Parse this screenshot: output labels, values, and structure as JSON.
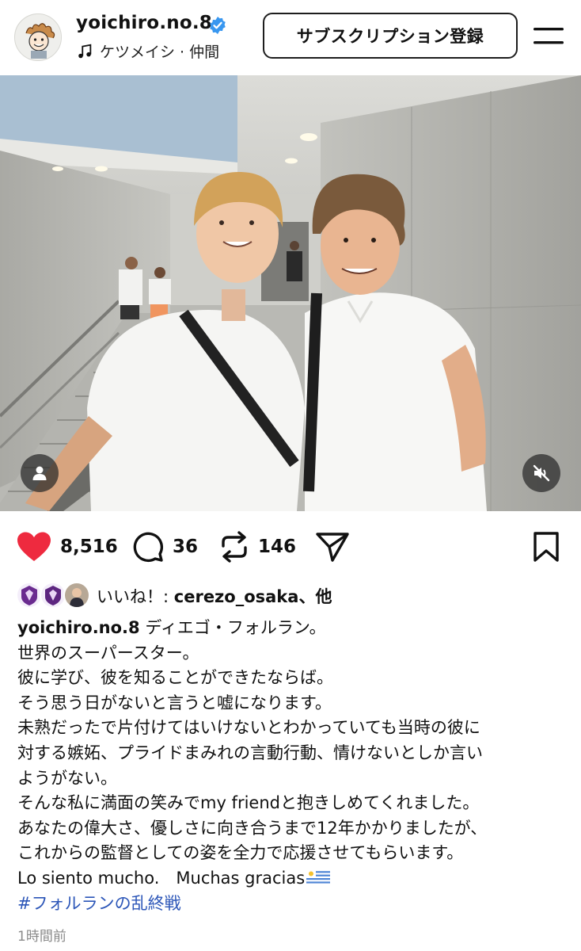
{
  "header": {
    "username": "yoichiro.no.8",
    "music": "ケツメイシ · 仲間",
    "subscribe_label": "サブスクリプション登録"
  },
  "photo": {
    "icons": [
      "user-tag-icon",
      "muted-speaker-icon"
    ]
  },
  "actions": {
    "like_count": "8,516",
    "comment_count": "36",
    "repost_count": "146"
  },
  "likes": {
    "prefix": "いいね！: ",
    "user": "cerezo_osaka",
    "suffix": "、他"
  },
  "caption": {
    "owner": "yoichiro.no.8",
    "first_line": " ディエゴ・フォルラン。",
    "lines": [
      "世界のスーパースター。",
      "彼に学び、彼を知ることができたならば。",
      "そう思う日がないと言うと嘘になります。",
      "未熟だったで片付けてはいけないとわかっていても当時の彼に",
      "対する嫉妬、プライドまみれの言動行動、情けないとしか言い",
      "ようがない。",
      "そんな私に満面の笑みでmy friendと抱きしめてくれました。",
      "あなたの偉大さ、優しさに向き合うまで12年かかりましたが、",
      "これからの監督としての姿を全力で応援させてもらいます。"
    ],
    "last_line": "Lo siento mucho.　Muchas gracias",
    "hashtag": "#フォルランの乱終戦"
  },
  "timestamp": "1時間前",
  "colors": {
    "heart": "#ee2a3f",
    "verified": "#3897f0",
    "hashtag": "#2c56b8",
    "timestamp": "#8a8a8a"
  }
}
